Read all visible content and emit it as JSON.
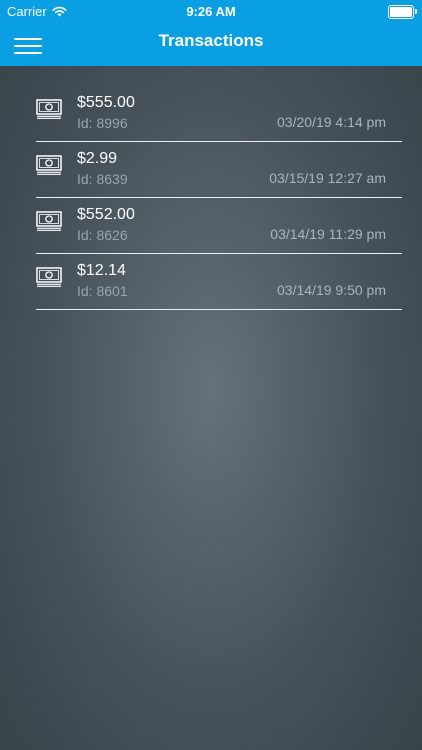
{
  "status_bar": {
    "carrier": "Carrier",
    "time": "9:26 AM"
  },
  "nav": {
    "title": "Transactions",
    "menu_icon": "hamburger-menu-icon"
  },
  "colors": {
    "nav_background": "#0a9ee2",
    "amount_text": "#ffffff",
    "secondary_text": "#9aa5ac",
    "divider": "#e9eef1"
  },
  "transactions": [
    {
      "amount": "$555.00",
      "id": "Id: 8996",
      "datetime": "03/20/19 4:14 pm",
      "icon": "money-bill-icon"
    },
    {
      "amount": "$2.99",
      "id": "Id: 8639",
      "datetime": "03/15/19 12:27 am",
      "icon": "money-bill-icon"
    },
    {
      "amount": "$552.00",
      "id": "Id: 8626",
      "datetime": "03/14/19 11:29 pm",
      "icon": "money-bill-icon"
    },
    {
      "amount": "$12.14",
      "id": "Id: 8601",
      "datetime": "03/14/19 9:50 pm",
      "icon": "money-bill-icon"
    }
  ]
}
